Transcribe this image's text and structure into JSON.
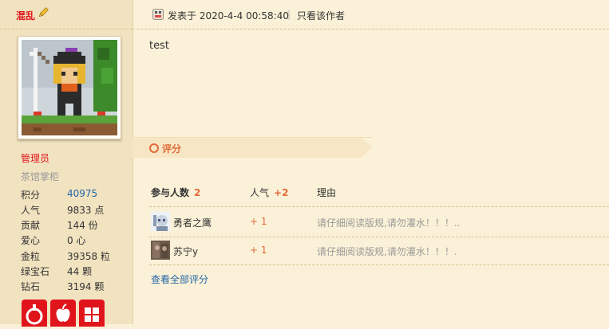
{
  "user": {
    "name": "混乱",
    "rank": "管理员",
    "title": "茶馆掌柜",
    "stats": [
      {
        "label": "积分",
        "value": "40975",
        "link": true
      },
      {
        "label": "人气",
        "value": "9833 点",
        "link": false
      },
      {
        "label": "贡献",
        "value": "144 份",
        "link": false
      },
      {
        "label": "爱心",
        "value": "0 心",
        "link": false
      },
      {
        "label": "金粒",
        "value": "39358 粒",
        "link": false
      },
      {
        "label": "绿宝石",
        "value": "44 颗",
        "link": false
      },
      {
        "label": "钻石",
        "value": "3194 颗",
        "link": false
      }
    ],
    "medals": [
      "medal-1",
      "medal-apple",
      "medal-grid"
    ]
  },
  "post": {
    "time_label": "发表于 2020-4-4 00:58:40",
    "separator": "|",
    "only_author_label": "只看该作者",
    "body": "test"
  },
  "rating": {
    "title": "评分",
    "headers": {
      "participants_label": "参与人数",
      "participants_count": "2",
      "popularity_label": "人气",
      "popularity_total": "+2",
      "reason_label": "理由"
    },
    "rows": [
      {
        "user": "勇者之鹰",
        "score": "+ 1",
        "reason": "请仔细阅读版规,请勿灌水！！！.."
      },
      {
        "user": "苏宁y",
        "score": "+ 1",
        "reason": "请仔细阅读版规,请勿灌水！！！."
      }
    ],
    "view_all_label": "查看全部评分"
  },
  "colors": {
    "accent_red": "#e1141c",
    "rating_orange": "#e06a37",
    "link_blue": "#2366a8",
    "page_bg": "#fbf1d8",
    "sidebar_bg": "#f2e3c0"
  }
}
